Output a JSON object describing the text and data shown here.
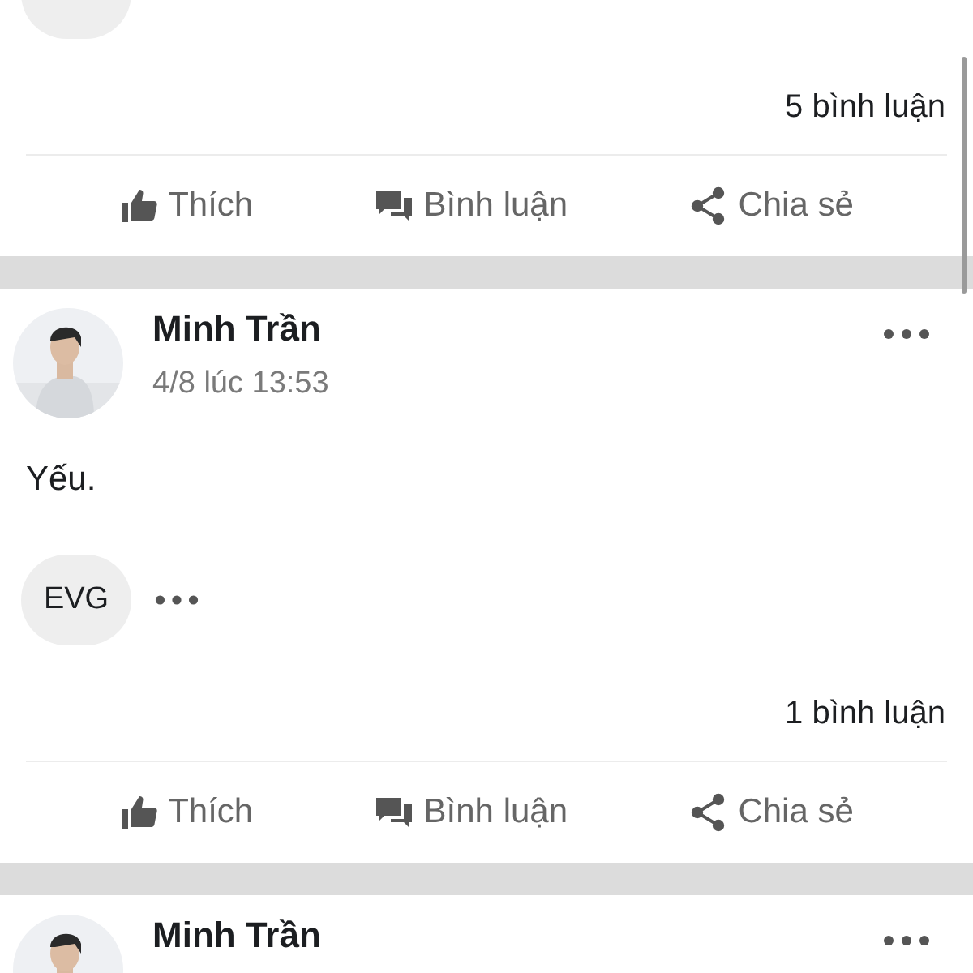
{
  "posts": [
    {
      "reaction_chip": true,
      "comment_count": "5 bình luận",
      "actions": [
        {
          "kind": "like",
          "label": "Thích"
        },
        {
          "kind": "comment",
          "label": "Bình luận"
        },
        {
          "kind": "share",
          "label": "Chia sẻ"
        }
      ]
    },
    {
      "author": "Minh Trần",
      "time": "4/8 lúc 13:53",
      "text": "Yếu.",
      "reaction_label": "EVG",
      "comment_count": "1 bình luận",
      "actions": [
        {
          "kind": "like",
          "label": "Thích"
        },
        {
          "kind": "comment",
          "label": "Bình luận"
        },
        {
          "kind": "share",
          "label": "Chia sẻ"
        }
      ]
    },
    {
      "author": "Minh Trần"
    }
  ]
}
